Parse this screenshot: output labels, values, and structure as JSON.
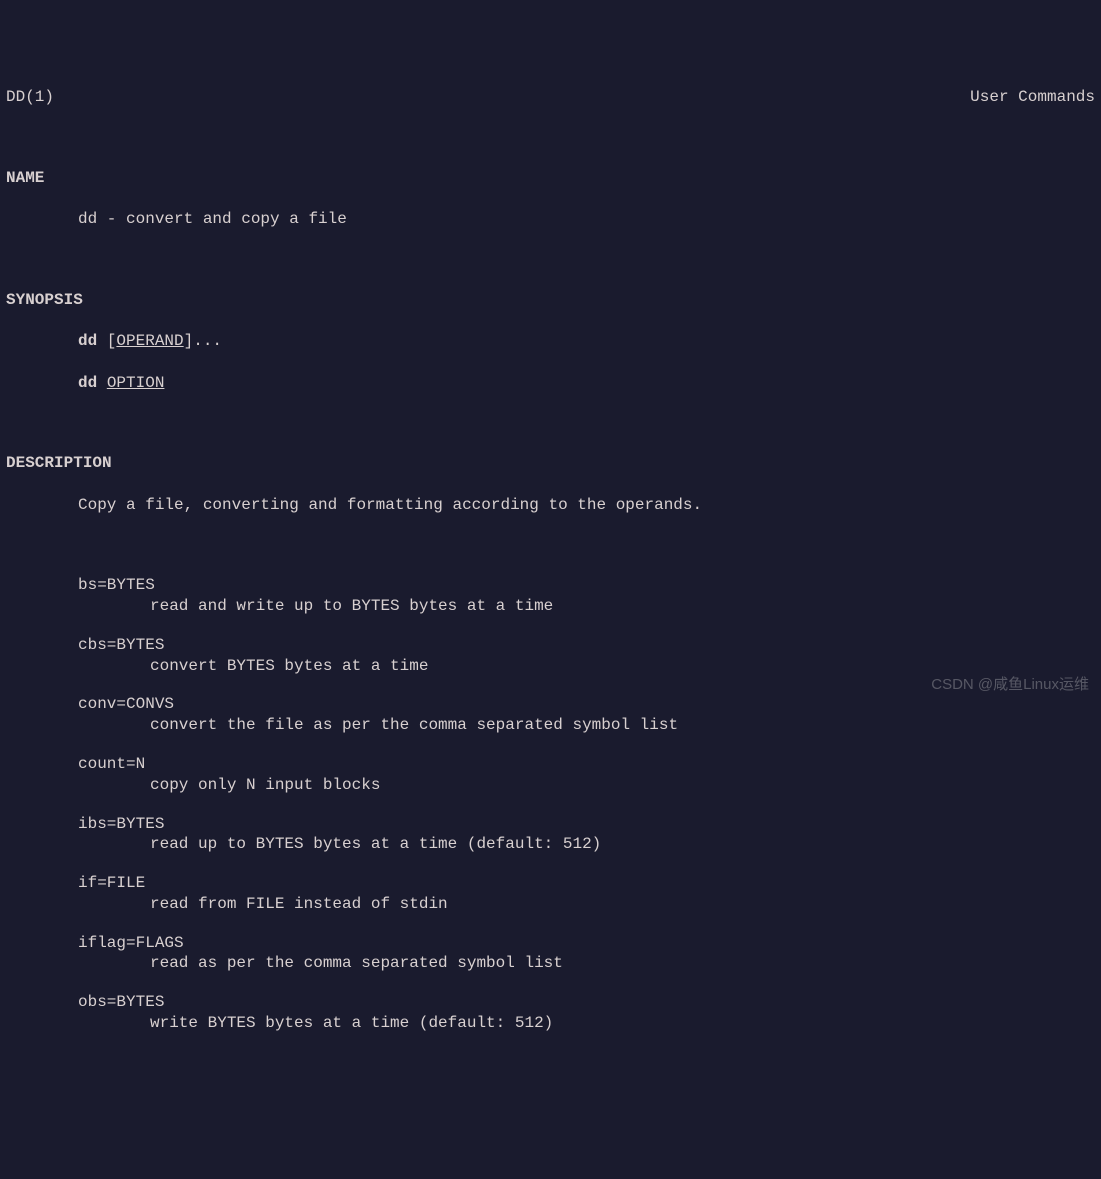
{
  "header": {
    "left": "DD(1)",
    "right": "User Commands"
  },
  "sections": {
    "name": {
      "heading": "NAME",
      "text": "dd - convert and copy a file"
    },
    "synopsis": {
      "heading": "SYNOPSIS",
      "line1_cmd": "dd",
      "line1_arg": "OPERAND",
      "line1_suffix": "]...",
      "line1_prefix": " [",
      "line2_cmd": "dd",
      "line2_arg": "OPTION"
    },
    "description": {
      "heading": "DESCRIPTION",
      "intro": "Copy a file, converting and formatting according to the operands.",
      "options": [
        {
          "key": "bs=BYTES",
          "desc": "read and write up to BYTES bytes at a time"
        },
        {
          "key": "cbs=BYTES",
          "desc": "convert BYTES bytes at a time"
        },
        {
          "key": "conv=CONVS",
          "desc": "convert the file as per the comma separated symbol list"
        },
        {
          "key": "count=N",
          "desc": "copy only N input blocks"
        },
        {
          "key": "ibs=BYTES",
          "desc": "read up to BYTES bytes at a time (default: 512)"
        },
        {
          "key": "if=FILE",
          "desc": "read from FILE instead of stdin"
        },
        {
          "key": "iflag=FLAGS",
          "desc": "read as per the comma separated symbol list"
        },
        {
          "key": "obs=BYTES",
          "desc": "write BYTES bytes at a time (default: 512)"
        }
      ]
    }
  },
  "watermark": "CSDN @咸鱼Linux运维"
}
